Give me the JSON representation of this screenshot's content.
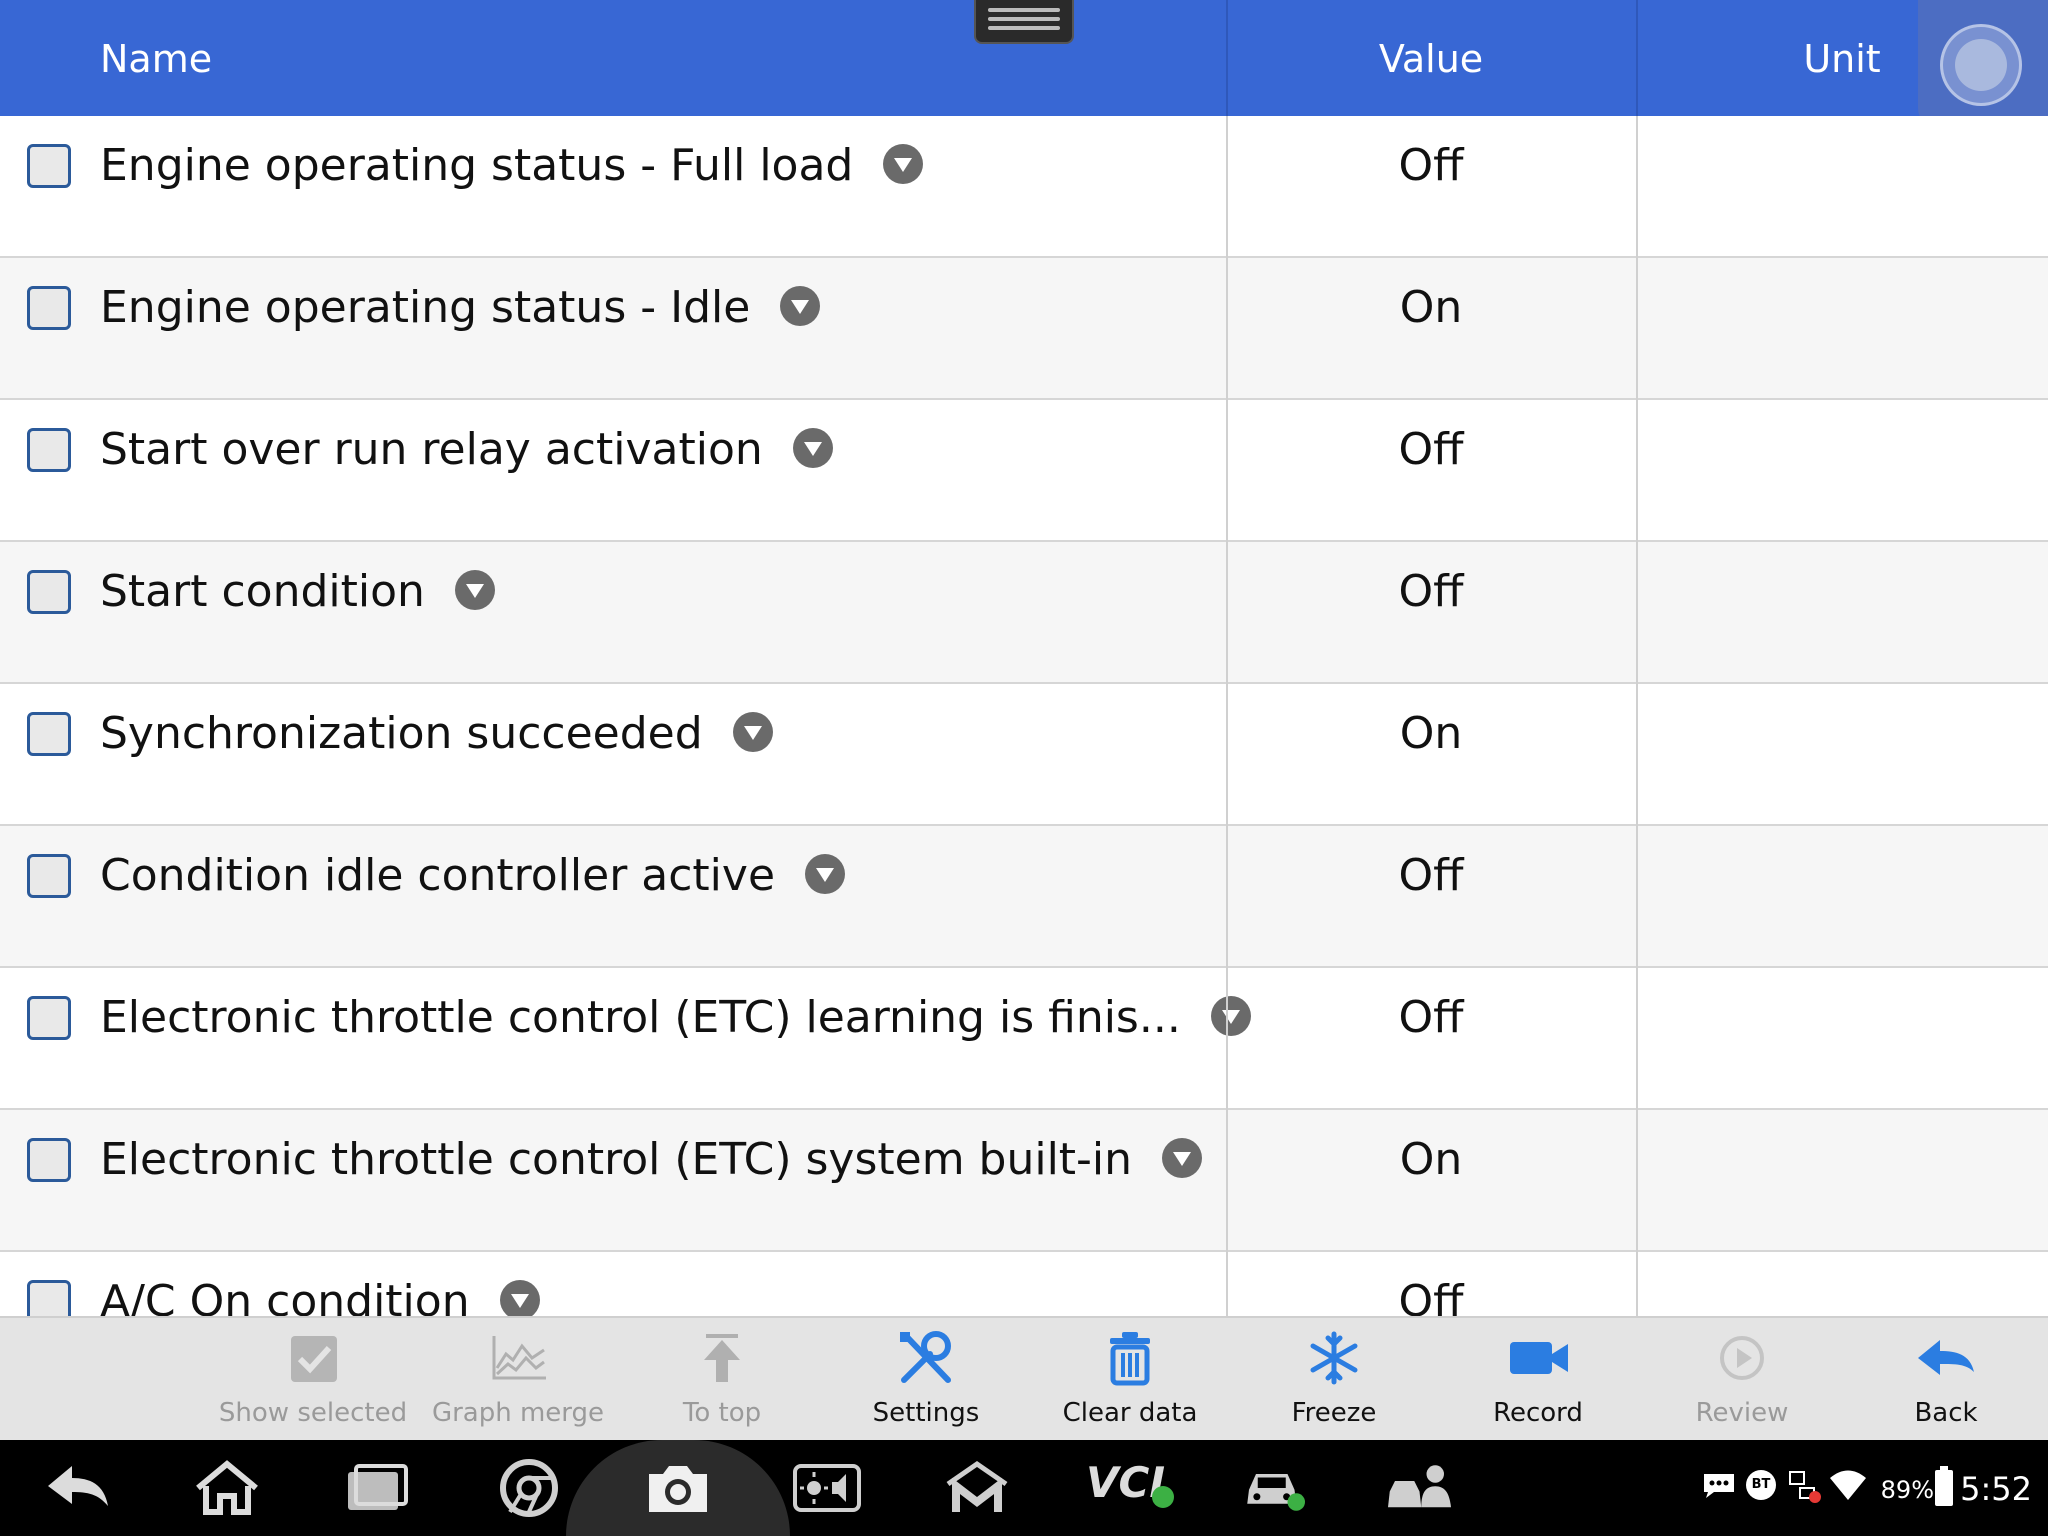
{
  "header": {
    "name": "Name",
    "value": "Value",
    "unit": "Unit"
  },
  "rows": [
    {
      "name": "Engine operating status - Full load",
      "value": "Off",
      "unit": ""
    },
    {
      "name": "Engine operating status - Idle",
      "value": "On",
      "unit": ""
    },
    {
      "name": "Start over run relay activation",
      "value": "Off",
      "unit": ""
    },
    {
      "name": "Start condition",
      "value": "Off",
      "unit": ""
    },
    {
      "name": "Synchronization succeeded",
      "value": "On",
      "unit": ""
    },
    {
      "name": "Condition idle controller active",
      "value": "Off",
      "unit": ""
    },
    {
      "name": "Electronic throttle control (ETC) learning is finis...",
      "value": "Off",
      "unit": ""
    },
    {
      "name": "Electronic throttle control (ETC) system built-in",
      "value": "On",
      "unit": ""
    },
    {
      "name": "A/C On condition",
      "value": "Off",
      "unit": ""
    }
  ],
  "toolbar": {
    "show_selected": "Show selected",
    "graph_merge": "Graph merge",
    "to_top": "To top",
    "settings": "Settings",
    "clear_data": "Clear data",
    "freeze": "Freeze",
    "record": "Record",
    "review": "Review",
    "back": "Back"
  },
  "status": {
    "battery": "89%",
    "time": "5:52",
    "bt": "BT",
    "vci": "VCI"
  },
  "colors": {
    "header": "#3867d4",
    "accent": "#2b7de1",
    "toolbar": "#e4e4e4",
    "sysbar": "#000000"
  }
}
